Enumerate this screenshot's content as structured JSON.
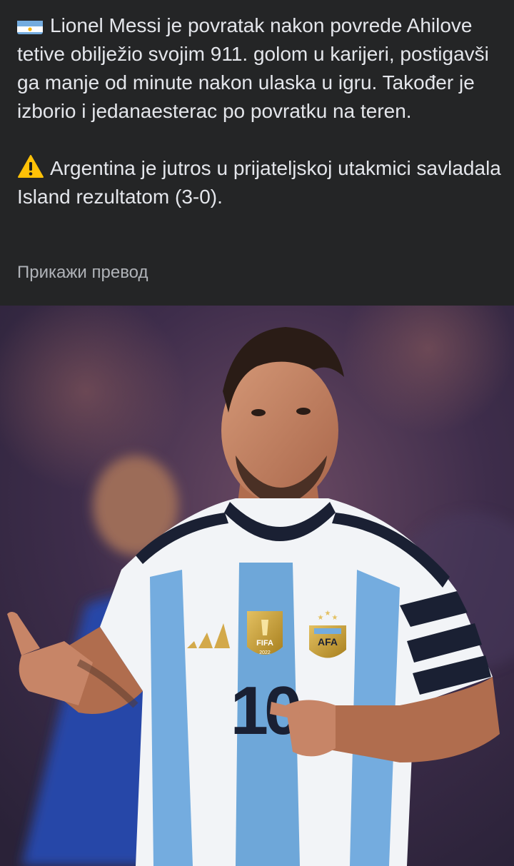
{
  "post": {
    "paragraph_1": "Lionel Messi je povratak nakon povrede Ahilove tetive obilježio svojim 911. golom u karijeri, postigavši ga manje od minute nakon ulaska u igru. Također je izborio i jedanaesterac po povratku na teren.",
    "paragraph_2": "Argentina je jutros u prijateljskoj utakmici savladala Island rezultatom (3-0).",
    "translate_label": "Прикажи превод",
    "icons": {
      "paragraph_1": "argentina-flag-icon",
      "paragraph_2": "warning-icon"
    }
  },
  "photo": {
    "jersey_number": "10",
    "badge_text": "FIFA",
    "badge_year": "2022",
    "crest_text": "AFA"
  },
  "colors": {
    "background": "#242526",
    "text": "#e4e6eb",
    "secondary_text": "#b0b3b8",
    "jersey_blue": "#74acdf",
    "jersey_stripe": "#1a2033"
  }
}
